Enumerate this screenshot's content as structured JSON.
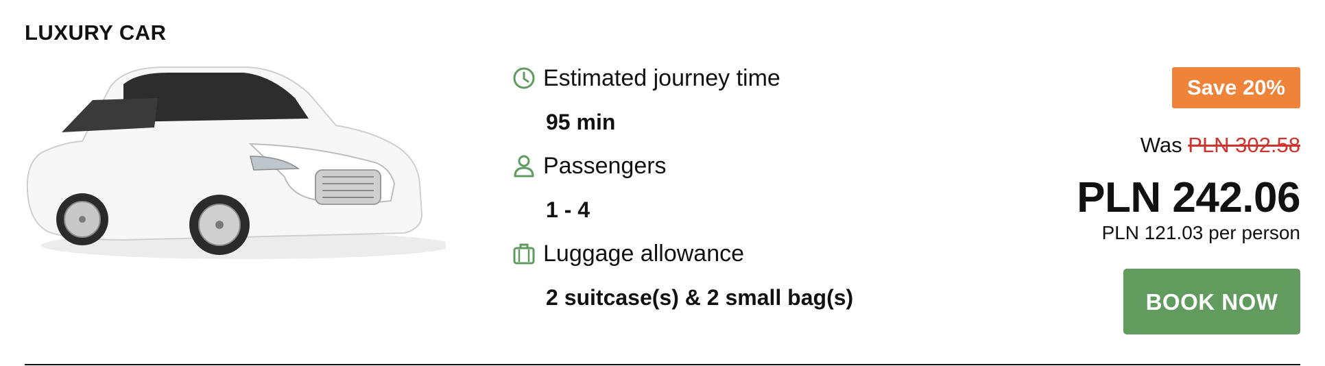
{
  "card": {
    "title": "LUXURY CAR",
    "car_image_alt": "white luxury sedan"
  },
  "details": {
    "journey": {
      "icon": "clock-icon",
      "label": "Estimated journey time",
      "value": "95 min"
    },
    "passengers": {
      "icon": "person-icon",
      "label": "Passengers",
      "value": "1 - 4"
    },
    "luggage": {
      "icon": "suitcase-icon",
      "label": "Luggage allowance",
      "value": "2 suitcase(s) & 2 small bag(s)"
    }
  },
  "pricing": {
    "save_badge": "Save 20%",
    "was_prefix": "Was",
    "was_price": "PLN 302.58",
    "price": "PLN 242.06",
    "per_person": "PLN 121.03 per person"
  },
  "actions": {
    "book_label": "BOOK NOW"
  },
  "colors": {
    "accent_green": "#619b5e",
    "badge_orange": "#f0833a",
    "strike_red": "#d0332e",
    "icon_green": "#5f9b5e"
  }
}
